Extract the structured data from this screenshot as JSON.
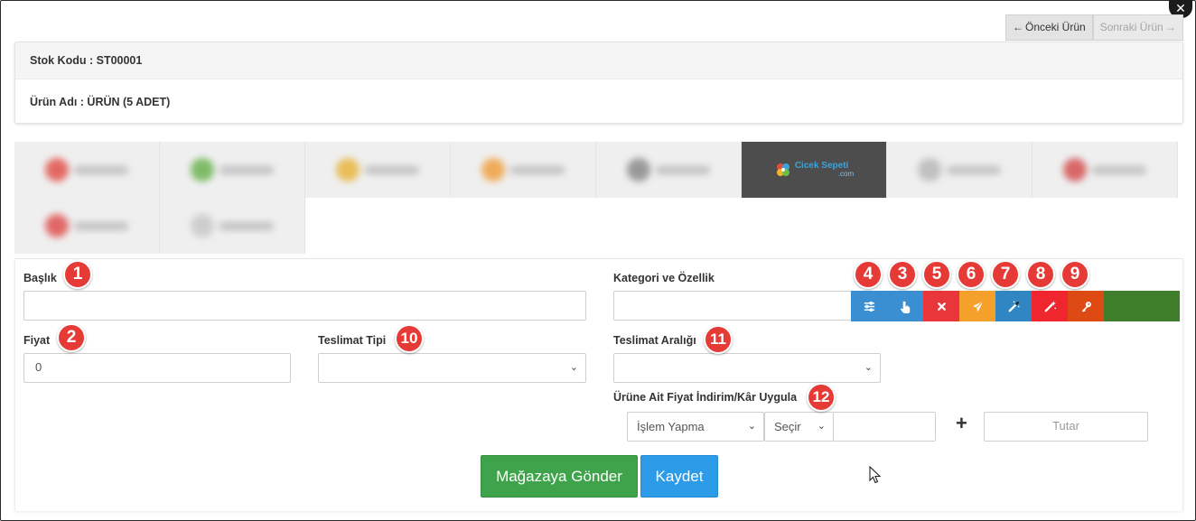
{
  "nav": {
    "prev_label": "Önceki Ürün",
    "next_label": "Sonraki Ürün",
    "close_label": "✕"
  },
  "product": {
    "stock_code": "Stok Kodu : ST00001",
    "name": "Ürün Adı : ÜRÜN (5 ADET)"
  },
  "shops": {
    "active_logo_text": "Cicek Sepeti",
    "active_logo_sub": ".com",
    "colors": [
      "#e0524a",
      "#6bb24e",
      "#e8b640",
      "#f0a040",
      "#8a8a8a",
      "#ffffff",
      "#b8b8b8",
      "#d45050",
      "#e05050",
      "#c8c8c8"
    ]
  },
  "form": {
    "baslik_label": "Başlık",
    "baslik_value": "",
    "kategori_label": "Kategori ve Özellik",
    "kategori_value": "",
    "fiyat_label": "Fiyat",
    "fiyat_value": "0",
    "teslimat_tipi_label": "Teslimat Tipi",
    "teslimat_tipi_value": "",
    "teslimat_araligi_label": "Teslimat Aralığı",
    "teslimat_araligi_value": "",
    "indirim_label": "Ürüne Ait Fiyat İndirim/Kâr Uygula",
    "islem_value": "İşlem Yapma",
    "secim_value": "Seçir",
    "tutar_placeholder": "Tutar",
    "plus": "+"
  },
  "badges": [
    "1",
    "2",
    "3",
    "4",
    "5",
    "6",
    "7",
    "8",
    "9",
    "10",
    "11",
    "12"
  ],
  "toolbar_colors": {
    "settings": "#3a8fd3",
    "pointer": "#3a8fd3",
    "remove": "#e8363b",
    "send": "#f5a02a",
    "magic": "#2f86c2",
    "magic_red": "#f0262e",
    "key": "#dd4a14"
  },
  "actions": {
    "send_label": "Mağazaya Gönder",
    "save_label": "Kaydet"
  },
  "accent": {
    "green": "#3ea34a",
    "blue": "#2c9be8",
    "badge": "#e63a36"
  }
}
